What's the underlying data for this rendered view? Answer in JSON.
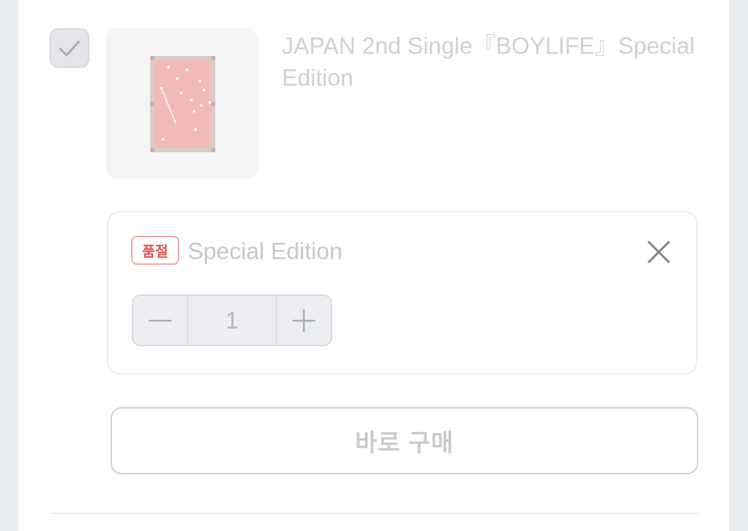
{
  "product": {
    "title": "JAPAN 2nd Single『BOYLIFE』Special Edition",
    "checked": true,
    "thumbnail_icon": "billiard-table-image"
  },
  "option": {
    "badge": "품절",
    "name": "Special Edition",
    "quantity": "1",
    "minus_icon": "minus-icon",
    "plus_icon": "plus-icon",
    "close_icon": "close-icon"
  },
  "actions": {
    "buy_now_label": "바로 구매"
  },
  "colors": {
    "soldout": "#e94d4d",
    "text_muted": "#cfd1d4",
    "thumbnail_pink": "#f2b9b6"
  }
}
